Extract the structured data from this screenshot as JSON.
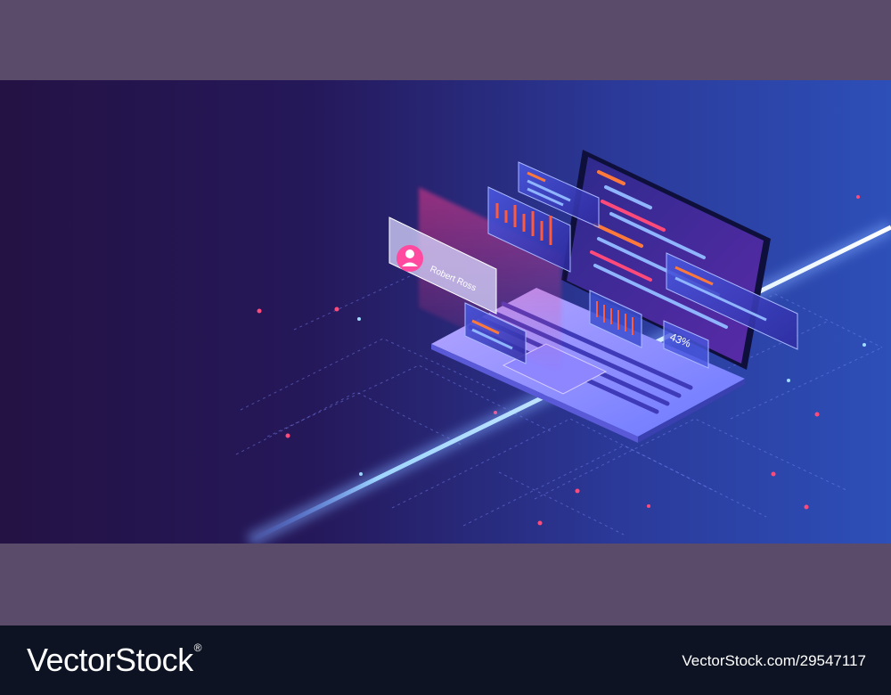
{
  "illustration": {
    "profile_card": {
      "name": "Robert Ross"
    },
    "progress_widget": {
      "percent_label": "43%"
    },
    "colors": {
      "bg_left": "#241244",
      "bg_right": "#2d4fb8",
      "neon_line": "#7fc8ff",
      "accent_pink": "#ff3c8c",
      "accent_orange": "#ff7a3a",
      "panel": "#3d4fd0"
    }
  },
  "footer": {
    "brand": "VectorStock",
    "registered_mark": "®",
    "image_id": "VectorStock.com/29547117"
  }
}
